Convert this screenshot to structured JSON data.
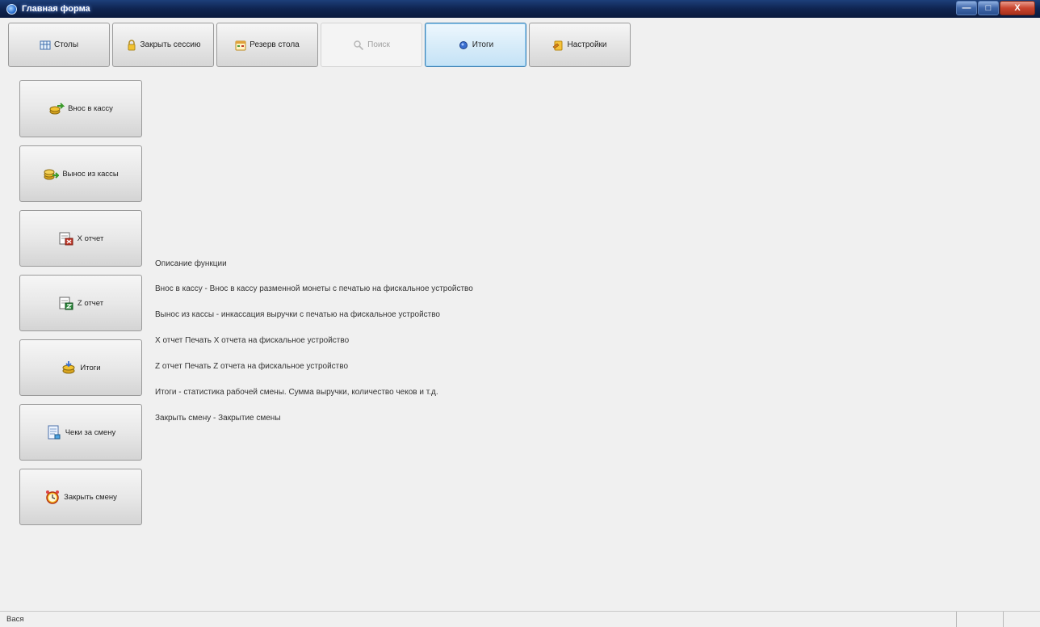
{
  "window": {
    "title": "Главная форма",
    "controls": {
      "minimize": "—",
      "maximize": "□",
      "close": "X"
    }
  },
  "toolbar": [
    {
      "label": "Столы",
      "icon": "tables-icon",
      "state": "normal"
    },
    {
      "label": "Закрыть сессию",
      "icon": "lock-icon",
      "state": "normal"
    },
    {
      "label": "Резерв стола",
      "icon": "reserve-icon",
      "state": "normal"
    },
    {
      "label": "Поиск",
      "icon": "search-icon",
      "state": "disabled"
    },
    {
      "label": "Итоги",
      "icon": "totals-icon",
      "state": "active"
    },
    {
      "label": "Настройки",
      "icon": "settings-icon",
      "state": "normal"
    }
  ],
  "side_buttons": [
    {
      "label": "Внос в кассу",
      "icon": "cash-in-icon"
    },
    {
      "label": "Вынос из кассы",
      "icon": "cash-out-icon"
    },
    {
      "label": "X отчет",
      "icon": "x-report-icon"
    },
    {
      "label": "Z отчет",
      "icon": "z-report-icon"
    },
    {
      "label": "Итоги",
      "icon": "totals-coins-icon"
    },
    {
      "label": "Чеки за смену",
      "icon": "receipts-icon"
    },
    {
      "label": "Закрыть смену",
      "icon": "alarm-clock-icon"
    }
  ],
  "description": {
    "title": "Описание функции",
    "lines": [
      "Внос в кассу - Внос в кассу разменной монеты с печатью на фискальное устройство",
      "Вынос из кассы - инкассация выручки с печатью на фискальное устройство",
      "X отчет Печать X отчета на фискальное устройство",
      "Z отчет Печать Z отчета на фискальное устройство",
      "Итоги - статистика рабочей смены. Сумма выручки, количество чеков и т.д.",
      "Закрыть смену - Закрытие смены"
    ]
  },
  "statusbar": {
    "user": "Вася"
  },
  "colors": {
    "titlebar": "#0f2450",
    "background": "#f0f0f0",
    "active_button_border": "#3c7fb1"
  }
}
